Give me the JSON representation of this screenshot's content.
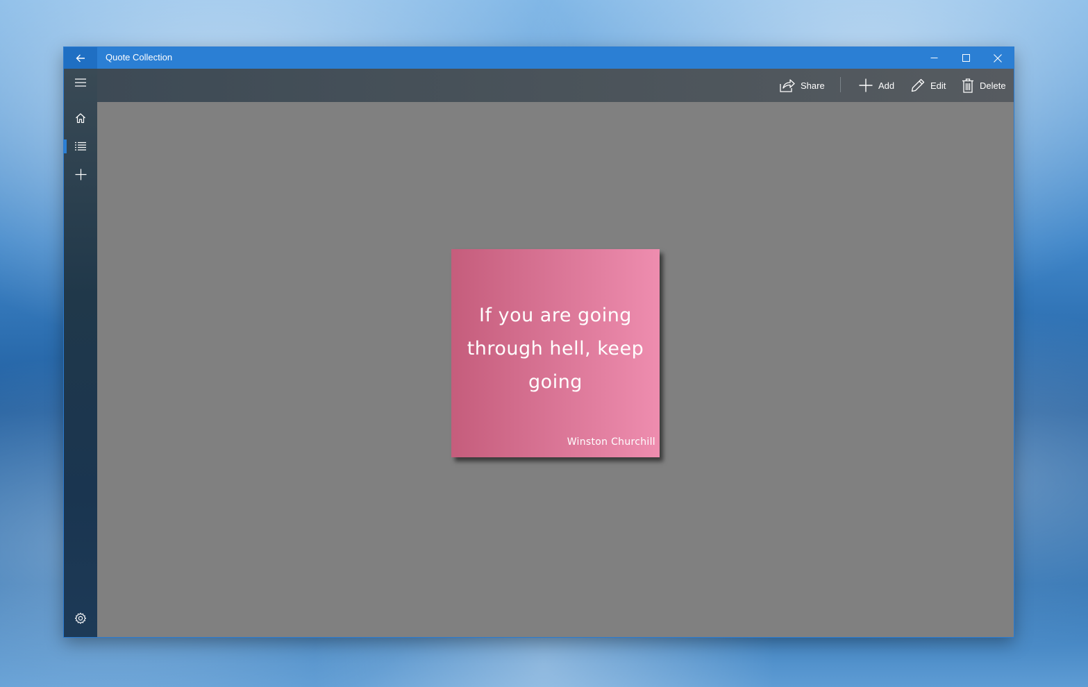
{
  "window": {
    "title": "Quote Collection"
  },
  "sidebar": {
    "items": [
      {
        "icon": "hamburger-menu-icon"
      },
      {
        "icon": "home-icon"
      },
      {
        "icon": "list-icon",
        "active": true
      },
      {
        "icon": "add-icon"
      },
      {
        "icon": "gear-icon"
      }
    ]
  },
  "commandbar": {
    "share_label": "Share",
    "add_label": "Add",
    "edit_label": "Edit",
    "delete_label": "Delete"
  },
  "quote": {
    "text": "If you are going through hell, keep going",
    "author": "Winston Churchill",
    "gradient_start": "#c55d7c",
    "gradient_end": "#ee8daf"
  },
  "colors": {
    "accent": "#2b7fd4",
    "content_background": "#808080"
  }
}
